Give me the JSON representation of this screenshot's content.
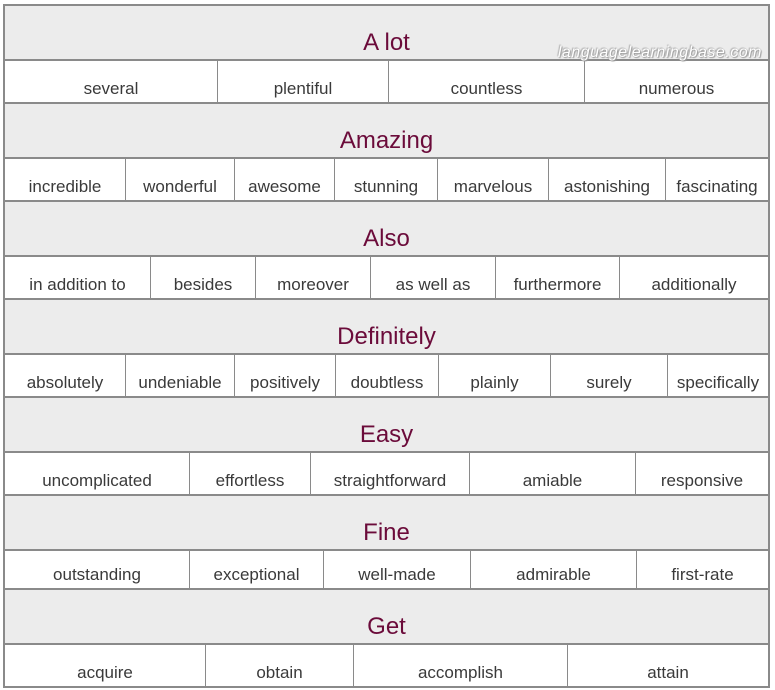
{
  "watermark": "languagelearningbase.com",
  "colors": {
    "heading": "#6b0b3a",
    "header_bg": "#ececec",
    "border": "#8a8a8a",
    "word_text": "#3a3a3a"
  },
  "sections": [
    {
      "heading": "A lot",
      "words": [
        "several",
        "plentiful",
        "countless",
        "numerous"
      ]
    },
    {
      "heading": "Amazing",
      "words": [
        "incredible",
        "wonderful",
        "awesome",
        "stunning",
        "marvelous",
        "astonishing",
        "fascinating"
      ]
    },
    {
      "heading": "Also",
      "words": [
        "in addition to",
        "besides",
        "moreover",
        "as well as",
        "furthermore",
        "additionally"
      ]
    },
    {
      "heading": "Definitely",
      "words": [
        "absolutely",
        "undeniable",
        "positively",
        "doubtless",
        "plainly",
        "surely",
        "specifically"
      ]
    },
    {
      "heading": "Easy",
      "words": [
        "uncomplicated",
        "effortless",
        "straightforward",
        "amiable",
        "responsive"
      ]
    },
    {
      "heading": "Fine",
      "words": [
        "outstanding",
        "exceptional",
        "well-made",
        "admirable",
        "first-rate"
      ]
    },
    {
      "heading": "Get",
      "words": [
        "acquire",
        "obtain",
        "accomplish",
        "attain"
      ]
    }
  ]
}
